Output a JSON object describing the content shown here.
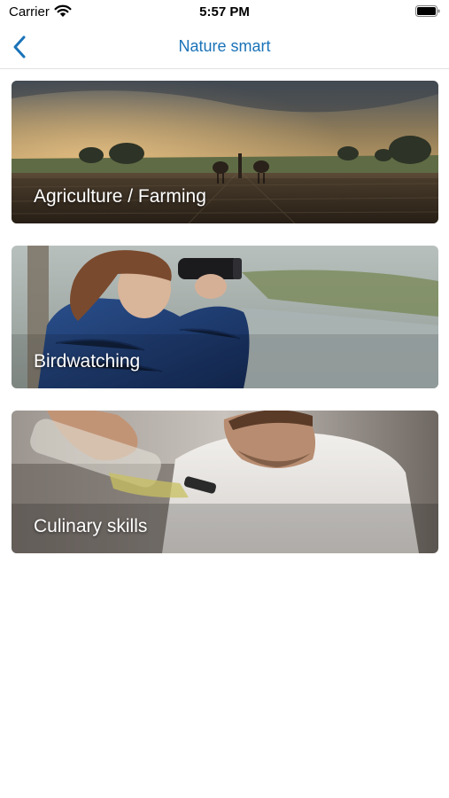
{
  "status_bar": {
    "carrier": "Carrier",
    "time": "5:57 PM",
    "wifi_icon": "wifi-icon",
    "battery_icon": "battery-icon"
  },
  "nav": {
    "title": "Nature smart",
    "back_icon": "chevron-left-icon",
    "accent_color": "#1a73b8"
  },
  "cards": [
    {
      "label": "Agriculture / Farming",
      "image": "farm-field-with-oxen-image"
    },
    {
      "label": "Birdwatching",
      "image": "person-with-binoculars-image"
    },
    {
      "label": "Culinary skills",
      "image": "chef-pouring-oil-image"
    }
  ]
}
